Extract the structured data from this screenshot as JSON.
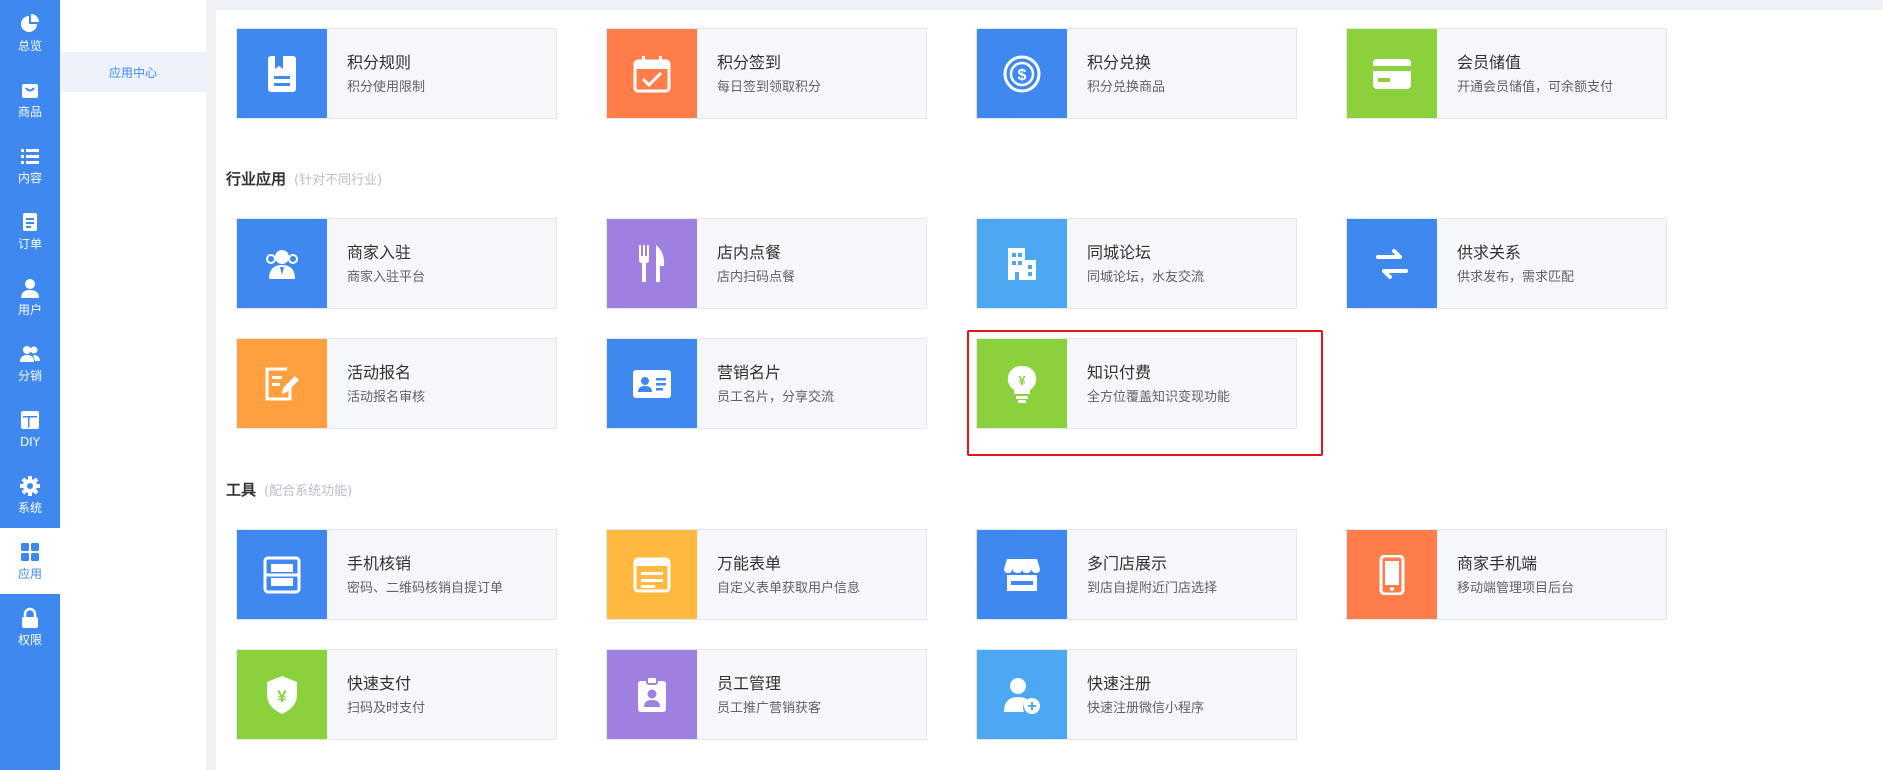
{
  "sidebar": {
    "items": [
      {
        "label": "总览",
        "icon": "pie-chart-icon"
      },
      {
        "label": "商品",
        "icon": "shopping-bag-icon"
      },
      {
        "label": "内容",
        "icon": "list-icon"
      },
      {
        "label": "订单",
        "icon": "order-doc-icon"
      },
      {
        "label": "用户",
        "icon": "user-icon"
      },
      {
        "label": "分销",
        "icon": "users-icon"
      },
      {
        "label": "DIY",
        "icon": "layout-icon"
      },
      {
        "label": "系统",
        "icon": "gear-icon"
      },
      {
        "label": "应用",
        "icon": "grid-icon",
        "active": true
      },
      {
        "label": "权限",
        "icon": "lock-icon"
      }
    ]
  },
  "submenu": {
    "active_item": "应用中心"
  },
  "sections": {
    "industry": {
      "title": "行业应用",
      "subtitle": "(针对不同行业)"
    },
    "tools": {
      "title": "工具",
      "subtitle": "(配合系统功能)"
    }
  },
  "cards": {
    "points_rules": {
      "title": "积分规则",
      "desc": "积分使用限制",
      "color": "#3f88ef",
      "icon": "bookmark-doc-icon"
    },
    "points_checkin": {
      "title": "积分签到",
      "desc": "每日签到领取积分",
      "color": "#ff7d4a",
      "icon": "calendar-check-icon"
    },
    "points_exchange": {
      "title": "积分兑换",
      "desc": "积分兑换商品",
      "color": "#3f88ef",
      "icon": "dollar-coin-icon"
    },
    "member_recharge": {
      "title": "会员储值",
      "desc": "开通会员储值，可余额支付",
      "color": "#8bd13b",
      "icon": "card-icon"
    },
    "merchant_join": {
      "title": "商家入驻",
      "desc": "商家入驻平台",
      "color": "#3f88ef",
      "icon": "merchant-users-icon"
    },
    "dine_in": {
      "title": "店内点餐",
      "desc": "店内扫码点餐",
      "color": "#9f7fe0",
      "icon": "fork-knife-icon"
    },
    "city_forum": {
      "title": "同城论坛",
      "desc": "同城论坛，水友交流",
      "color": "#4ca8f2",
      "icon": "building-icon"
    },
    "supply_demand": {
      "title": "供求关系",
      "desc": "供求发布，需求匹配",
      "color": "#3f88ef",
      "icon": "swap-arrows-icon"
    },
    "event_signup": {
      "title": "活动报名",
      "desc": "活动报名审核",
      "color": "#ff9f3f",
      "icon": "edit-form-icon"
    },
    "marketing_card": {
      "title": "营销名片",
      "desc": "员工名片，分享交流",
      "color": "#3f88ef",
      "icon": "id-card-icon"
    },
    "paid_knowledge": {
      "title": "知识付费",
      "desc": "全方位覆盖知识变现功能",
      "color": "#8bd13b",
      "icon": "bulb-yen-icon"
    },
    "mobile_verify": {
      "title": "手机核销",
      "desc": "密码、二维码核销自提订单",
      "color": "#3f88ef",
      "icon": "scan-icon"
    },
    "universal_form": {
      "title": "万能表单",
      "desc": "自定义表单获取用户信息",
      "color": "#ffb840",
      "icon": "form-icon"
    },
    "multi_store": {
      "title": "多门店展示",
      "desc": "到店自提附近门店选择",
      "color": "#3f88ef",
      "icon": "store-icon"
    },
    "merchant_mobile": {
      "title": "商家手机端",
      "desc": "移动端管理项目后台",
      "color": "#ff7d4a",
      "icon": "phone-icon"
    },
    "quick_pay": {
      "title": "快速支付",
      "desc": "扫码及时支付",
      "color": "#8bd13b",
      "icon": "shield-yen-icon"
    },
    "staff_manage": {
      "title": "员工管理",
      "desc": "员工推广营销获客",
      "color": "#9f7fe0",
      "icon": "badge-icon"
    },
    "quick_register": {
      "title": "快速注册",
      "desc": "快速注册微信小程序",
      "color": "#4ca8f2",
      "icon": "user-add-icon"
    }
  }
}
